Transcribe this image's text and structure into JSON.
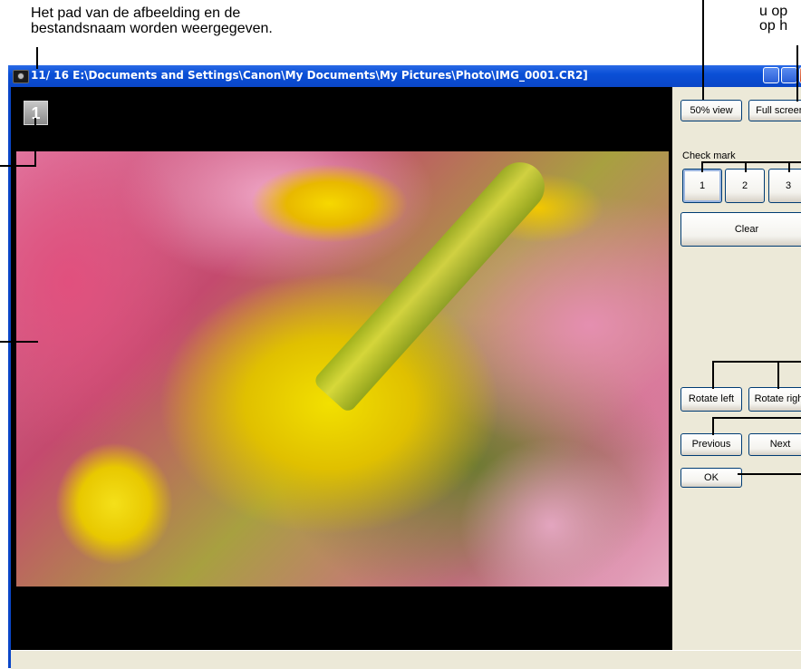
{
  "annotations": {
    "path_note_line1": "Het pad van de afbeelding en de",
    "path_note_line2": "bestandsnaam worden weergegeven.",
    "right_note_line1": "u op",
    "right_note_line2": "op h"
  },
  "window": {
    "title": "11/ 16  E:\\Documents and Settings\\Canon\\My Documents\\My Pictures\\Photo\\IMG_0001.CR2]"
  },
  "viewer": {
    "image_number_badge": "1"
  },
  "panel": {
    "view_50_label": "50% view",
    "full_screen_label": "Full screen",
    "check_mark_label": "Check mark",
    "check_1": "1",
    "check_2": "2",
    "check_3": "3",
    "clear_label": "Clear",
    "rotate_left_label": "Rotate left",
    "rotate_right_label": "Rotate right",
    "previous_label": "Previous",
    "next_label": "Next",
    "ok_label": "OK"
  },
  "colors": {
    "titlebar": "#0a46c8",
    "panel_bg": "#ece9d8",
    "button_border": "#003c74"
  }
}
